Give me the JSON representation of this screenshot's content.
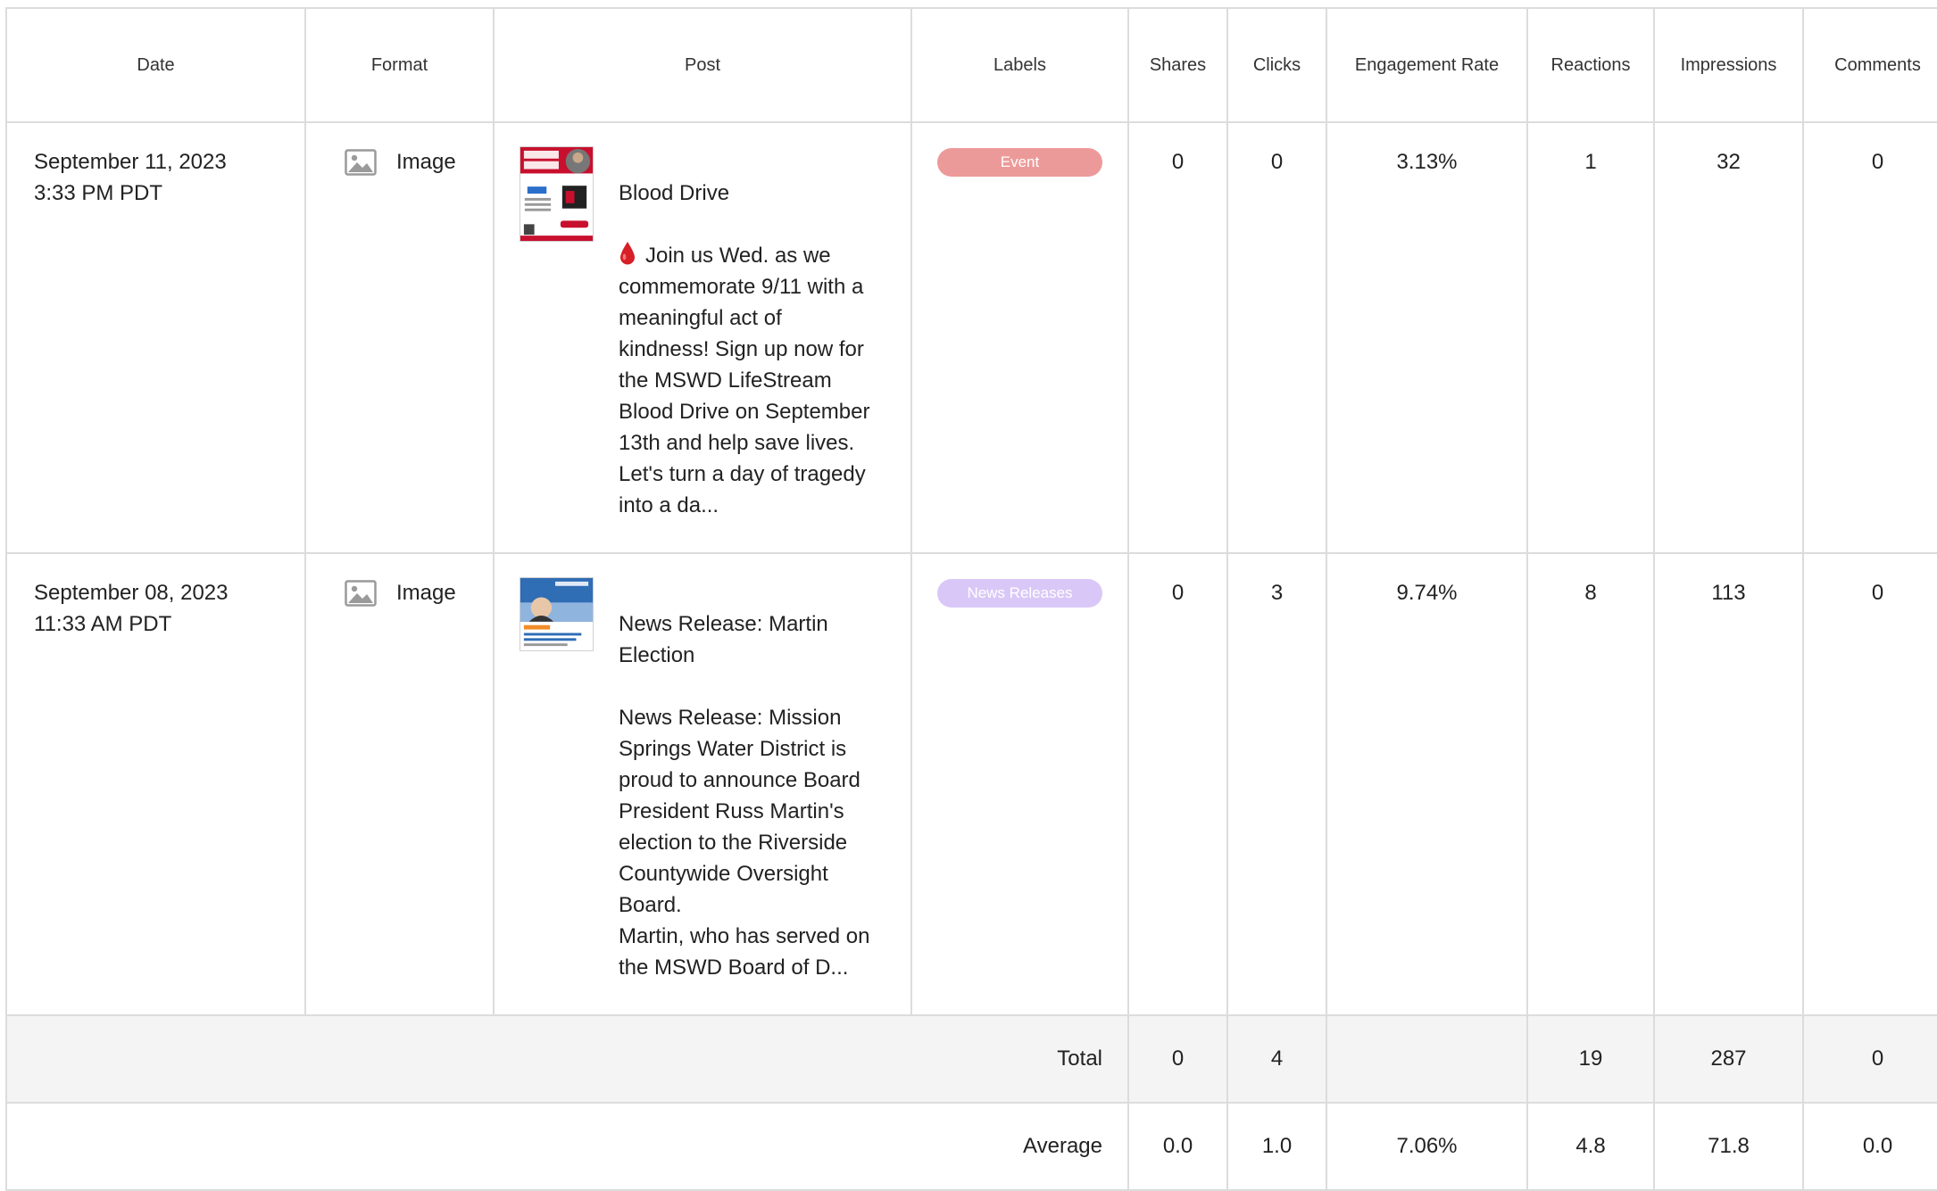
{
  "columns": [
    "Date",
    "Format",
    "Post",
    "Labels",
    "Shares",
    "Clicks",
    "Engagement Rate",
    "Reactions",
    "Impressions",
    "Comments"
  ],
  "rows": [
    {
      "date": "September 11, 2023\n3:33 PM PDT",
      "format": "Image",
      "format_icon": "image-icon",
      "thumbnail": "blood-drive-flyer-thumbnail",
      "post_title": "Blood Drive",
      "post_emoji": "drop-of-blood",
      "post_body": "Join us Wed. as we\ncommemorate 9/11 with a\nmeaningful act of\nkindness! Sign up now for\nthe MSWD LifeStream\nBlood Drive on September\n13th and help save lives.\nLet's turn a day of tragedy\ninto a da...",
      "label": "Event",
      "label_color": "#ec9a99",
      "shares": "0",
      "clicks": "0",
      "engagement_rate": "3.13%",
      "reactions": "1",
      "impressions": "32",
      "comments": "0"
    },
    {
      "date": "September 08, 2023\n11:33 AM PDT",
      "format": "Image",
      "format_icon": "image-icon",
      "thumbnail": "news-release-thumbnail",
      "post_title": "News Release: Martin\nElection",
      "post_body": "News Release: Mission\nSprings Water District is\nproud to announce Board\nPresident Russ Martin's\nelection to the Riverside\nCountywide Oversight\nBoard.\nMartin, who has served on\nthe MSWD Board of D...",
      "label": "News Releases",
      "label_color": "#d9c8f7",
      "shares": "0",
      "clicks": "3",
      "engagement_rate": "9.74%",
      "reactions": "8",
      "impressions": "113",
      "comments": "0"
    }
  ],
  "total": {
    "label": "Total",
    "shares": "0",
    "clicks": "4",
    "engagement_rate": "",
    "reactions": "19",
    "impressions": "287",
    "comments": "0"
  },
  "average": {
    "label": "Average",
    "shares": "0.0",
    "clicks": "1.0",
    "engagement_rate": "7.06%",
    "reactions": "4.8",
    "impressions": "71.8",
    "comments": "0.0"
  },
  "colors": {
    "border": "#dcdcdc",
    "total_row_bg": "#f4f4f4",
    "event_badge": "#ec9a99",
    "news_badge": "#d9c8f7"
  }
}
